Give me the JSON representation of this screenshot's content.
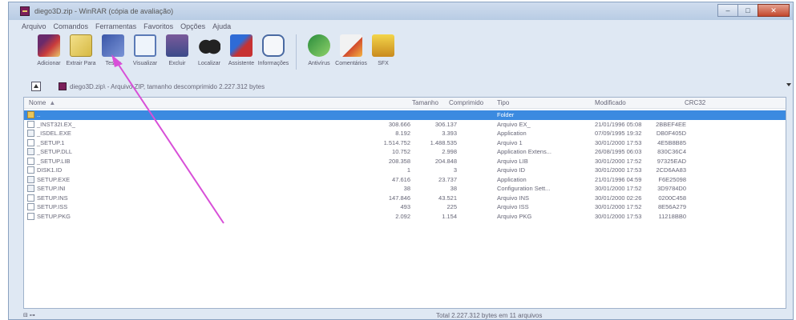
{
  "window": {
    "title": "diego3D.zip - WinRAR (cópia de avaliação)",
    "minimize": "–",
    "maximize": "□",
    "close": "✕"
  },
  "menu": [
    "Arquivo",
    "Comandos",
    "Ferramentas",
    "Favoritos",
    "Opções",
    "Ajuda"
  ],
  "toolbar": [
    {
      "label": "Adicionar",
      "icon": "add-archive-icon"
    },
    {
      "label": "Extrair Para",
      "icon": "extract-icon"
    },
    {
      "label": "Testar",
      "icon": "test-icon"
    },
    {
      "label": "Visualizar",
      "icon": "view-icon"
    },
    {
      "label": "Excluir",
      "icon": "delete-icon"
    },
    {
      "label": "Localizar",
      "icon": "find-icon"
    },
    {
      "label": "Assistente",
      "icon": "wizard-icon"
    },
    {
      "label": "Informações",
      "icon": "info-icon"
    },
    {
      "label": "Antivírus",
      "icon": "antivirus-icon"
    },
    {
      "label": "Comentários",
      "icon": "comment-icon"
    },
    {
      "label": "SFX",
      "icon": "sfx-icon"
    }
  ],
  "address": {
    "text": "diego3D.zip\\ - Arquivo ZIP, tamanho descomprimido 2.227.312 bytes"
  },
  "columns": {
    "name": "Nome",
    "size": "Tamanho",
    "packed": "Comprimido",
    "type": "Tipo",
    "modified": "Modificado",
    "crc": "CRC32"
  },
  "files": [
    {
      "name": "..",
      "size": "",
      "packed": "",
      "type": "Folder",
      "modified": "",
      "crc": "",
      "kind": "folder",
      "selected": true
    },
    {
      "name": "_INST32I.EX_",
      "size": "308.666",
      "packed": "306.137",
      "type": "Arquivo EX_",
      "modified": "21/01/1996 05:08",
      "crc": "2BBEF4EE",
      "kind": "file"
    },
    {
      "name": "_ISDEL.EXE",
      "size": "8.192",
      "packed": "3.393",
      "type": "Application",
      "modified": "07/09/1995 19:32",
      "crc": "DB0F405D",
      "kind": "app"
    },
    {
      "name": "_SETUP.1",
      "size": "1.514.752",
      "packed": "1.488.535",
      "type": "Arquivo 1",
      "modified": "30/01/2000 17:53",
      "crc": "4E5B8B85",
      "kind": "file"
    },
    {
      "name": "_SETUP.DLL",
      "size": "10.752",
      "packed": "2.998",
      "type": "Application Extens...",
      "modified": "26/08/1995 06:03",
      "crc": "830C36C4",
      "kind": "app"
    },
    {
      "name": "_SETUP.LIB",
      "size": "208.358",
      "packed": "204.848",
      "type": "Arquivo LIB",
      "modified": "30/01/2000 17:52",
      "crc": "97325EAD",
      "kind": "file"
    },
    {
      "name": "DISK1.ID",
      "size": "1",
      "packed": "3",
      "type": "Arquivo ID",
      "modified": "30/01/2000 17:53",
      "crc": "2CD6AA83",
      "kind": "file"
    },
    {
      "name": "SETUP.EXE",
      "size": "47.616",
      "packed": "23.737",
      "type": "Application",
      "modified": "21/01/1996 04:59",
      "crc": "F6E25098",
      "kind": "app"
    },
    {
      "name": "SETUP.INI",
      "size": "38",
      "packed": "38",
      "type": "Configuration Sett...",
      "modified": "30/01/2000 17:52",
      "crc": "3D9784D0",
      "kind": "app"
    },
    {
      "name": "SETUP.INS",
      "size": "147.846",
      "packed": "43.521",
      "type": "Arquivo INS",
      "modified": "30/01/2000 02:26",
      "crc": "0200C458",
      "kind": "file"
    },
    {
      "name": "SETUP.ISS",
      "size": "493",
      "packed": "225",
      "type": "Arquivo ISS",
      "modified": "30/01/2000 17:52",
      "crc": "8E56A279",
      "kind": "file"
    },
    {
      "name": "SETUP.PKG",
      "size": "2.092",
      "packed": "1.154",
      "type": "Arquivo PKG",
      "modified": "30/01/2000 17:53",
      "crc": "11218BB0",
      "kind": "file"
    }
  ],
  "status": {
    "left": "⊟ ⊶",
    "total": "Total 2.227.312 bytes em 11 arquivos"
  },
  "annotation": {
    "color": "#d84fd8"
  }
}
